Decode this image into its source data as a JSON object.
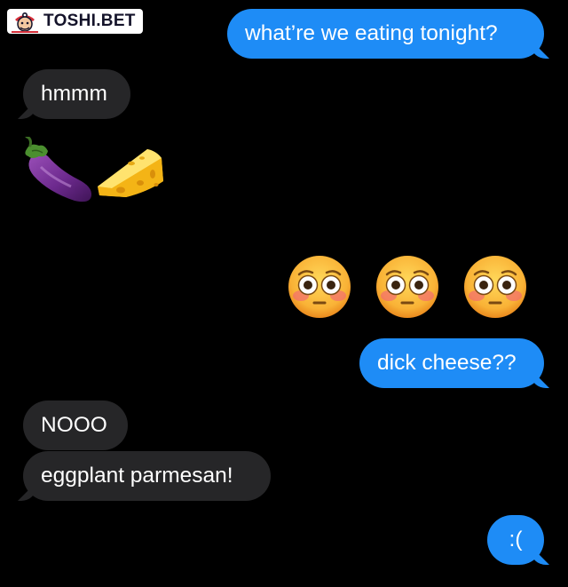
{
  "watermark": {
    "text": "TOSHI.BET"
  },
  "messages": [
    {
      "id": "msg1",
      "direction": "sent",
      "text": "what’re we eating tonight?"
    },
    {
      "id": "msg2",
      "direction": "received",
      "text": "hmmm"
    },
    {
      "id": "msg3",
      "direction": "received",
      "emoji": [
        "eggplant-icon",
        "cheese-icon"
      ]
    },
    {
      "id": "msg4",
      "direction": "sent",
      "emoji": [
        "flushed-face-icon",
        "flushed-face-icon",
        "flushed-face-icon"
      ]
    },
    {
      "id": "msg5",
      "direction": "sent",
      "text": "dick cheese??"
    },
    {
      "id": "msg6",
      "direction": "received",
      "text": "NOOO"
    },
    {
      "id": "msg7",
      "direction": "received",
      "text": "eggplant parmesan!"
    },
    {
      "id": "msg8",
      "direction": "sent",
      "text": ":("
    }
  ],
  "colors": {
    "background": "#000000",
    "sent_bubble": "#1e8cf6",
    "received_bubble": "#262628",
    "text": "#ffffff"
  }
}
